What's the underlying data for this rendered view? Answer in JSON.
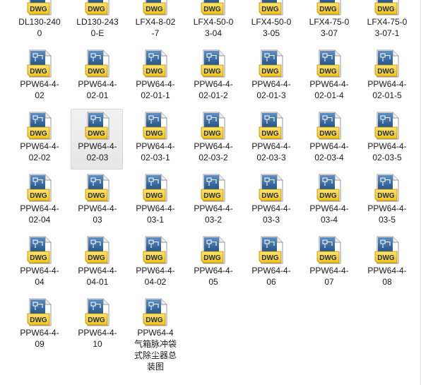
{
  "icon_type": "dwg-file-icon",
  "icon_text": "DWG",
  "colors": {
    "icon_blue": "#1f4e82",
    "icon_yellow": "#f0c419",
    "selection_bg": "#e8e8e8"
  },
  "files": [
    {
      "label": "DL130-240\n0"
    },
    {
      "label": "LD130-243\n0-E"
    },
    {
      "label": "LFX4-8-02\n-7"
    },
    {
      "label": "LFX4-50-0\n3-04"
    },
    {
      "label": "LFX4-50-0\n3-05"
    },
    {
      "label": "LFX4-75-0\n3-07"
    },
    {
      "label": "LFX4-75-0\n3-07-1"
    },
    {
      "label": "PPW64-4-\n02"
    },
    {
      "label": "PPW64-4-\n02-01"
    },
    {
      "label": "PPW64-4-\n02-01-1"
    },
    {
      "label": "PPW64-4-\n02-01-2"
    },
    {
      "label": "PPW64-4-\n02-01-3"
    },
    {
      "label": "PPW64-4-\n02-01-4"
    },
    {
      "label": "PPW64-4-\n02-01-5"
    },
    {
      "label": "PPW64-4-\n02-02"
    },
    {
      "label": "PPW64-4-\n02-03",
      "selected": true
    },
    {
      "label": "PPW64-4-\n02-03-1"
    },
    {
      "label": "PPW64-4-\n02-03-2"
    },
    {
      "label": "PPW64-4-\n02-03-3"
    },
    {
      "label": "PPW64-4-\n02-03-4"
    },
    {
      "label": "PPW64-4-\n02-03-5"
    },
    {
      "label": "PPW64-4-\n02-04"
    },
    {
      "label": "PPW64-4-\n03"
    },
    {
      "label": "PPW64-4-\n03-1"
    },
    {
      "label": "PPW64-4-\n03-2"
    },
    {
      "label": "PPW64-4-\n03-3"
    },
    {
      "label": "PPW64-4-\n03-4"
    },
    {
      "label": "PPW64-4-\n03-5"
    },
    {
      "label": "PPW64-4-\n04"
    },
    {
      "label": "PPW64-4-\n04-01"
    },
    {
      "label": "PPW64-4-\n04-02"
    },
    {
      "label": "PPW64-4-\n05"
    },
    {
      "label": "PPW64-4-\n06"
    },
    {
      "label": "PPW64-4-\n07"
    },
    {
      "label": "PPW64-4-\n08"
    },
    {
      "label": "PPW64-4-\n09"
    },
    {
      "label": "PPW64-4-\n10"
    },
    {
      "label": "PPW64-4\n气箱脉冲袋\n式除尘器总\n装图"
    }
  ]
}
